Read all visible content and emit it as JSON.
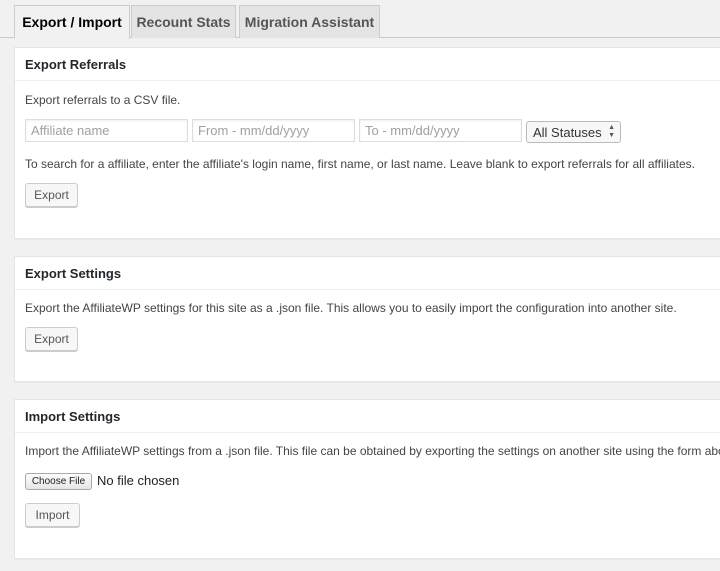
{
  "tabs": [
    {
      "label": "Export / Import",
      "active": true
    },
    {
      "label": "Recount Stats",
      "active": false
    },
    {
      "label": "Migration Assistant",
      "active": false
    }
  ],
  "export_referrals": {
    "title": "Export Referrals",
    "description": "Export referrals to a CSV file.",
    "affiliate_placeholder": "Affiliate name",
    "from_placeholder": "From - mm/dd/yyyy",
    "to_placeholder": "To - mm/dd/yyyy",
    "status_select": "All Statuses",
    "help": "To search for a affiliate, enter the affiliate's login name, first name, or last name. Leave blank to export referrals for all affiliates.",
    "button": "Export"
  },
  "export_settings": {
    "title": "Export Settings",
    "description": "Export the AffiliateWP settings for this site as a .json file. This allows you to easily import the configuration into another site.",
    "button": "Export"
  },
  "import_settings": {
    "title": "Import Settings",
    "description": "Import the AffiliateWP settings from a .json file. This file can be obtained by exporting the settings on another site using the form above.",
    "choose_file": "Choose File",
    "file_status": "No file chosen",
    "button": "Import"
  }
}
